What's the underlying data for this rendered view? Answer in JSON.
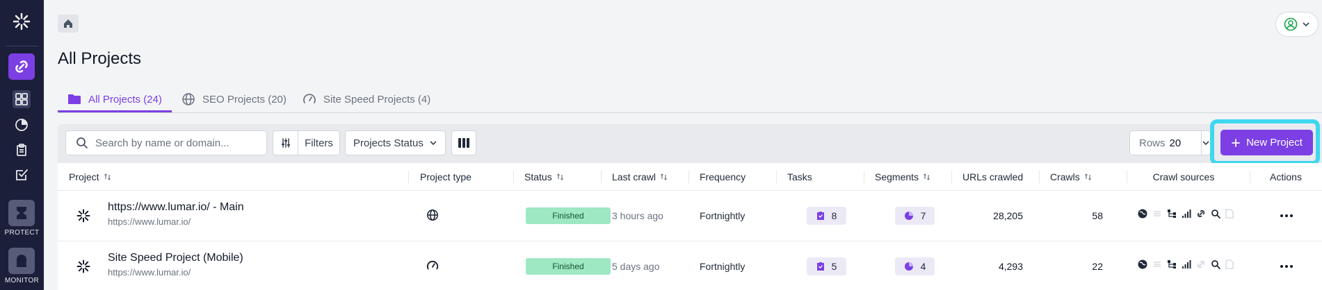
{
  "sidebar": {
    "apps": [
      {
        "label": "PROTECT"
      },
      {
        "label": "MONITOR"
      }
    ]
  },
  "page": {
    "title": "All Projects"
  },
  "tabs": [
    {
      "label": "All Projects (24)",
      "active": true
    },
    {
      "label": "SEO Projects (20)",
      "active": false
    },
    {
      "label": "Site Speed Projects (4)",
      "active": false
    }
  ],
  "toolbar": {
    "search_placeholder": "Search by name or domain...",
    "filters_label": "Filters",
    "status_label": "Projects Status",
    "rows_label": "Rows",
    "rows_value": "20",
    "new_project_label": "New Project"
  },
  "table": {
    "headers": {
      "project": "Project",
      "project_type": "Project type",
      "status": "Status",
      "last_crawl": "Last crawl",
      "frequency": "Frequency",
      "tasks": "Tasks",
      "segments": "Segments",
      "urls_crawled": "URLs crawled",
      "crawls": "Crawls",
      "crawl_sources": "Crawl sources",
      "actions": "Actions"
    },
    "rows": [
      {
        "name": "https://www.lumar.io/ - Main",
        "url": "https://www.lumar.io/",
        "type_icon": "globe-icon",
        "status": "Finished",
        "last_crawl": "3 hours ago",
        "frequency": "Fortnightly",
        "tasks": "8",
        "segments": "7",
        "urls_crawled": "28,205",
        "crawls": "58",
        "sources_active": [
          true,
          false,
          true,
          true,
          true,
          true,
          false
        ]
      },
      {
        "name": "Site Speed Project (Mobile)",
        "url": "https://www.lumar.io/",
        "type_icon": "gauge-icon",
        "status": "Finished",
        "last_crawl": "5 days ago",
        "frequency": "Fortnightly",
        "tasks": "5",
        "segments": "4",
        "urls_crawled": "4,293",
        "crawls": "22",
        "sources_active": [
          true,
          false,
          true,
          true,
          false,
          true,
          false
        ]
      }
    ]
  },
  "colors": {
    "brand": "#7b3fe4",
    "sidebar": "#1c1f3a",
    "status_finished": "#9ee8c4",
    "focus_ring": "#3fd7ee"
  }
}
